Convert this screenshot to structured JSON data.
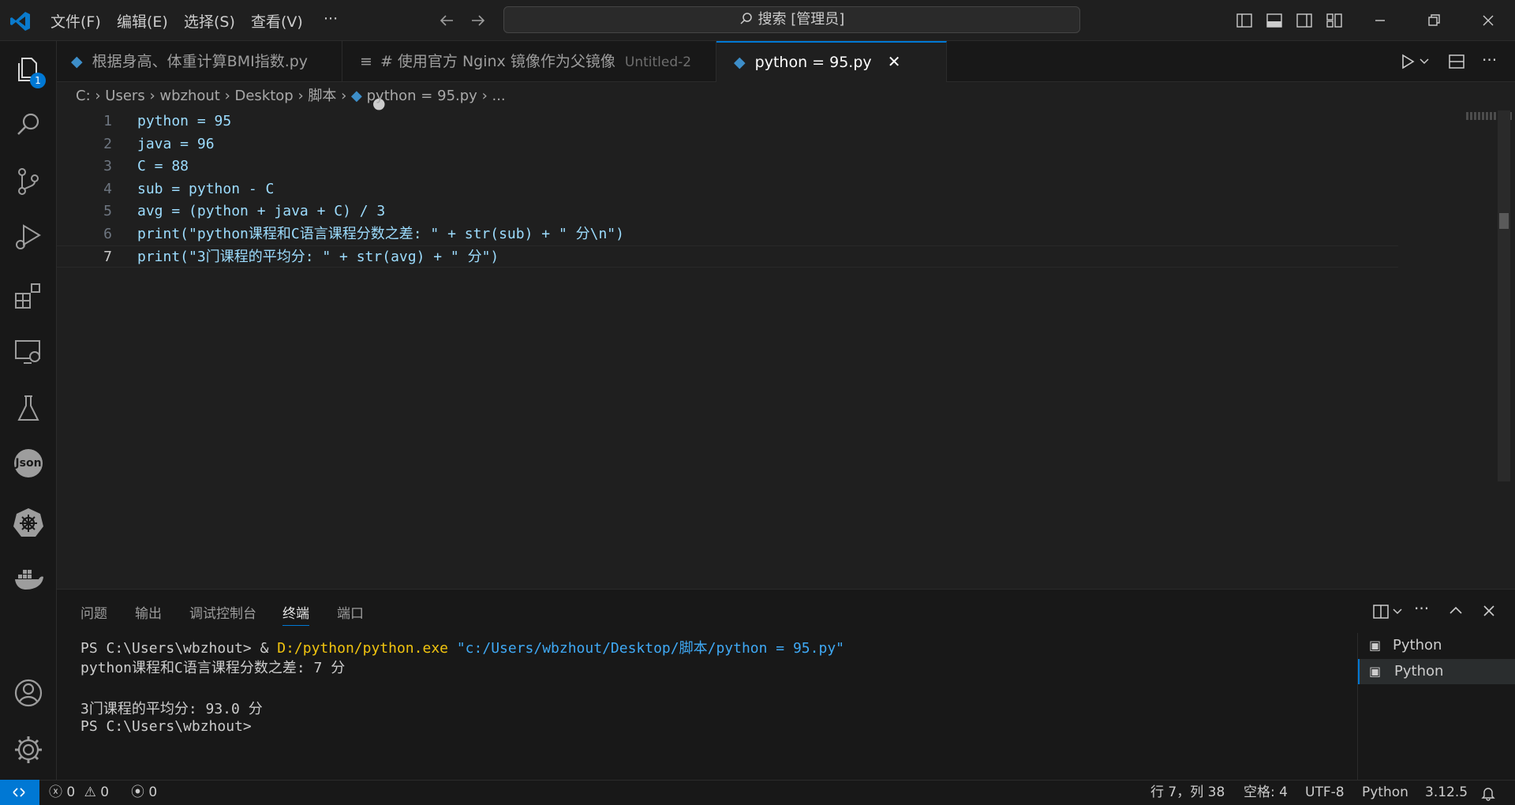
{
  "titlebar": {
    "menus": [
      "文件(F)",
      "编辑(E)",
      "选择(S)",
      "查看(V)",
      "···"
    ],
    "search_placeholder": "搜索 [管理员]"
  },
  "activity": {
    "explorer_badge": "1",
    "json_label": "Json"
  },
  "tabs": [
    {
      "label": "根据身高、体重计算BMI指数.py",
      "hint": "",
      "active": false
    },
    {
      "label": "# 使用官方 Nginx 镜像作为父镜像",
      "hint": "Untitled-2",
      "active": false,
      "modified": true
    },
    {
      "label": "python = 95.py",
      "hint": "",
      "active": true
    }
  ],
  "breadcrumb": [
    "C:",
    "Users",
    "wbzhout",
    "Desktop",
    "脚本",
    "python = 95.py",
    "..."
  ],
  "editor": {
    "line_numbers": [
      "1",
      "2",
      "3",
      "4",
      "5",
      "6",
      "7"
    ],
    "current_line": 7,
    "lines": [
      "python = 95",
      "java = 96",
      "C = 88",
      "sub = python - C",
      "avg = (python + java + C) / 3",
      "print(\"python课程和C语言课程分数之差: \" + str(sub) + \" 分\\n\")",
      "print(\"3门课程的平均分: \" + str(avg) + \" 分\")"
    ]
  },
  "panel": {
    "tabs": [
      "问题",
      "输出",
      "调试控制台",
      "终端",
      "端口"
    ],
    "active_tab": "终端",
    "terminal": {
      "cmd_prompt": "PS C:\\Users\\wbzhout> & ",
      "cmd_exe": "D:/python/python.exe",
      "cmd_arg": "\"c:/Users/wbzhout/Desktop/脚本/python = 95.py\"",
      "out1": "python课程和C语言课程分数之差: 7 分",
      "out2": "3门课程的平均分: 93.0 分",
      "prompt2": "PS C:\\Users\\wbzhout>"
    },
    "terminal_list": [
      "Python",
      "Python"
    ]
  },
  "statusbar": {
    "errors": "0",
    "warnings": "0",
    "ports": "0",
    "position": "行 7，列 38",
    "spaces": "空格: 4",
    "encoding": "UTF-8",
    "language": "Python",
    "version": "3.12.5"
  },
  "colors": {
    "accent": "#0078d4",
    "background": "#1f1f1f"
  }
}
